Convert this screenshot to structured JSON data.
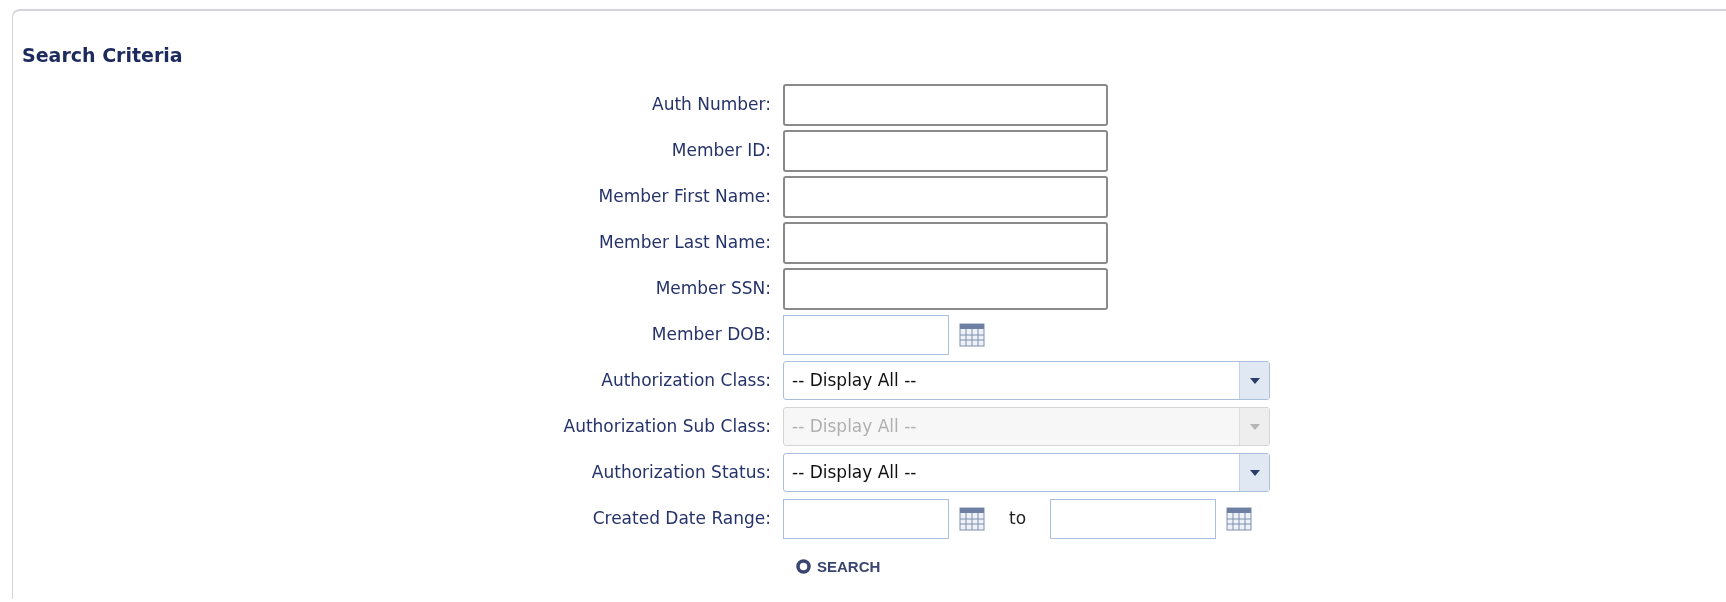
{
  "heading": "Search Criteria",
  "fields": [
    {
      "kind": "text",
      "label": "Auth Number:"
    },
    {
      "kind": "text",
      "label": "Member ID:"
    },
    {
      "kind": "text",
      "label": "Member First Name:"
    },
    {
      "kind": "text",
      "label": "Member Last Name:"
    },
    {
      "kind": "text",
      "label": "Member SSN:"
    },
    {
      "kind": "date",
      "label": "Member DOB:"
    },
    {
      "kind": "select",
      "label": "Authorization Class:",
      "value": "-- Display All --",
      "disabled": false
    },
    {
      "kind": "select",
      "label": "Authorization Sub Class:",
      "value": "-- Display All --",
      "disabled": true
    },
    {
      "kind": "select",
      "label": "Authorization Status:",
      "value": "-- Display All --",
      "disabled": false
    },
    {
      "kind": "daterange",
      "label": "Created Date Range:",
      "separator": "to"
    }
  ],
  "search_button": "SEARCH"
}
